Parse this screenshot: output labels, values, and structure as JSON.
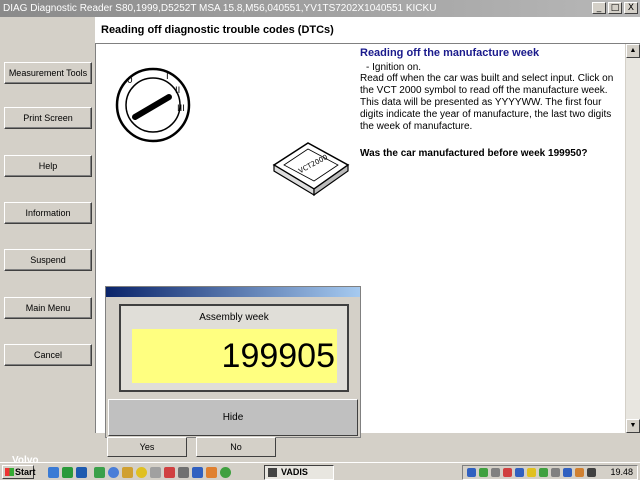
{
  "window": {
    "title": "DIAG Diagnostic Reader S80,1999,D5252T MSA 15.8,M56,040551,YV1TS7202X1040551 KICKU",
    "minimize": "_",
    "maximize": "□",
    "close": "X"
  },
  "header": {
    "title": "Reading off diagnostic trouble codes (DTCs)"
  },
  "sidebar": {
    "items": [
      {
        "label": "Measurement Tools"
      },
      {
        "label": "Print Screen"
      },
      {
        "label": "Help"
      },
      {
        "label": "Information"
      },
      {
        "label": "Suspend"
      },
      {
        "label": "Main Menu"
      },
      {
        "label": "Cancel"
      }
    ]
  },
  "info": {
    "title": "Reading off the manufacture week",
    "bullet": "-  Ignition on.",
    "body": "Read off when the car was built and select input. Click on the VCT 2000 symbol to read off the manufacture week. This data will be presented as YYYYWW. The first four digits indicate the year of manufacture, the last two digits the week of manufacture.",
    "question": "Was the car manufactured before week 199950?"
  },
  "device": {
    "label": "VCT2000"
  },
  "popup": {
    "label": "Assembly week",
    "value": "199905",
    "hide_label": "Hide"
  },
  "answers": {
    "yes": "Yes",
    "no": "No"
  },
  "taskbar": {
    "start_label": "Start",
    "task_label": "VADIS",
    "clock": "19.48",
    "watermark": "Volvo"
  },
  "colors": {
    "info_title": "#1a1a8c",
    "popup_value_bg": "#ffff80",
    "popup_bar": "#0a246a"
  }
}
